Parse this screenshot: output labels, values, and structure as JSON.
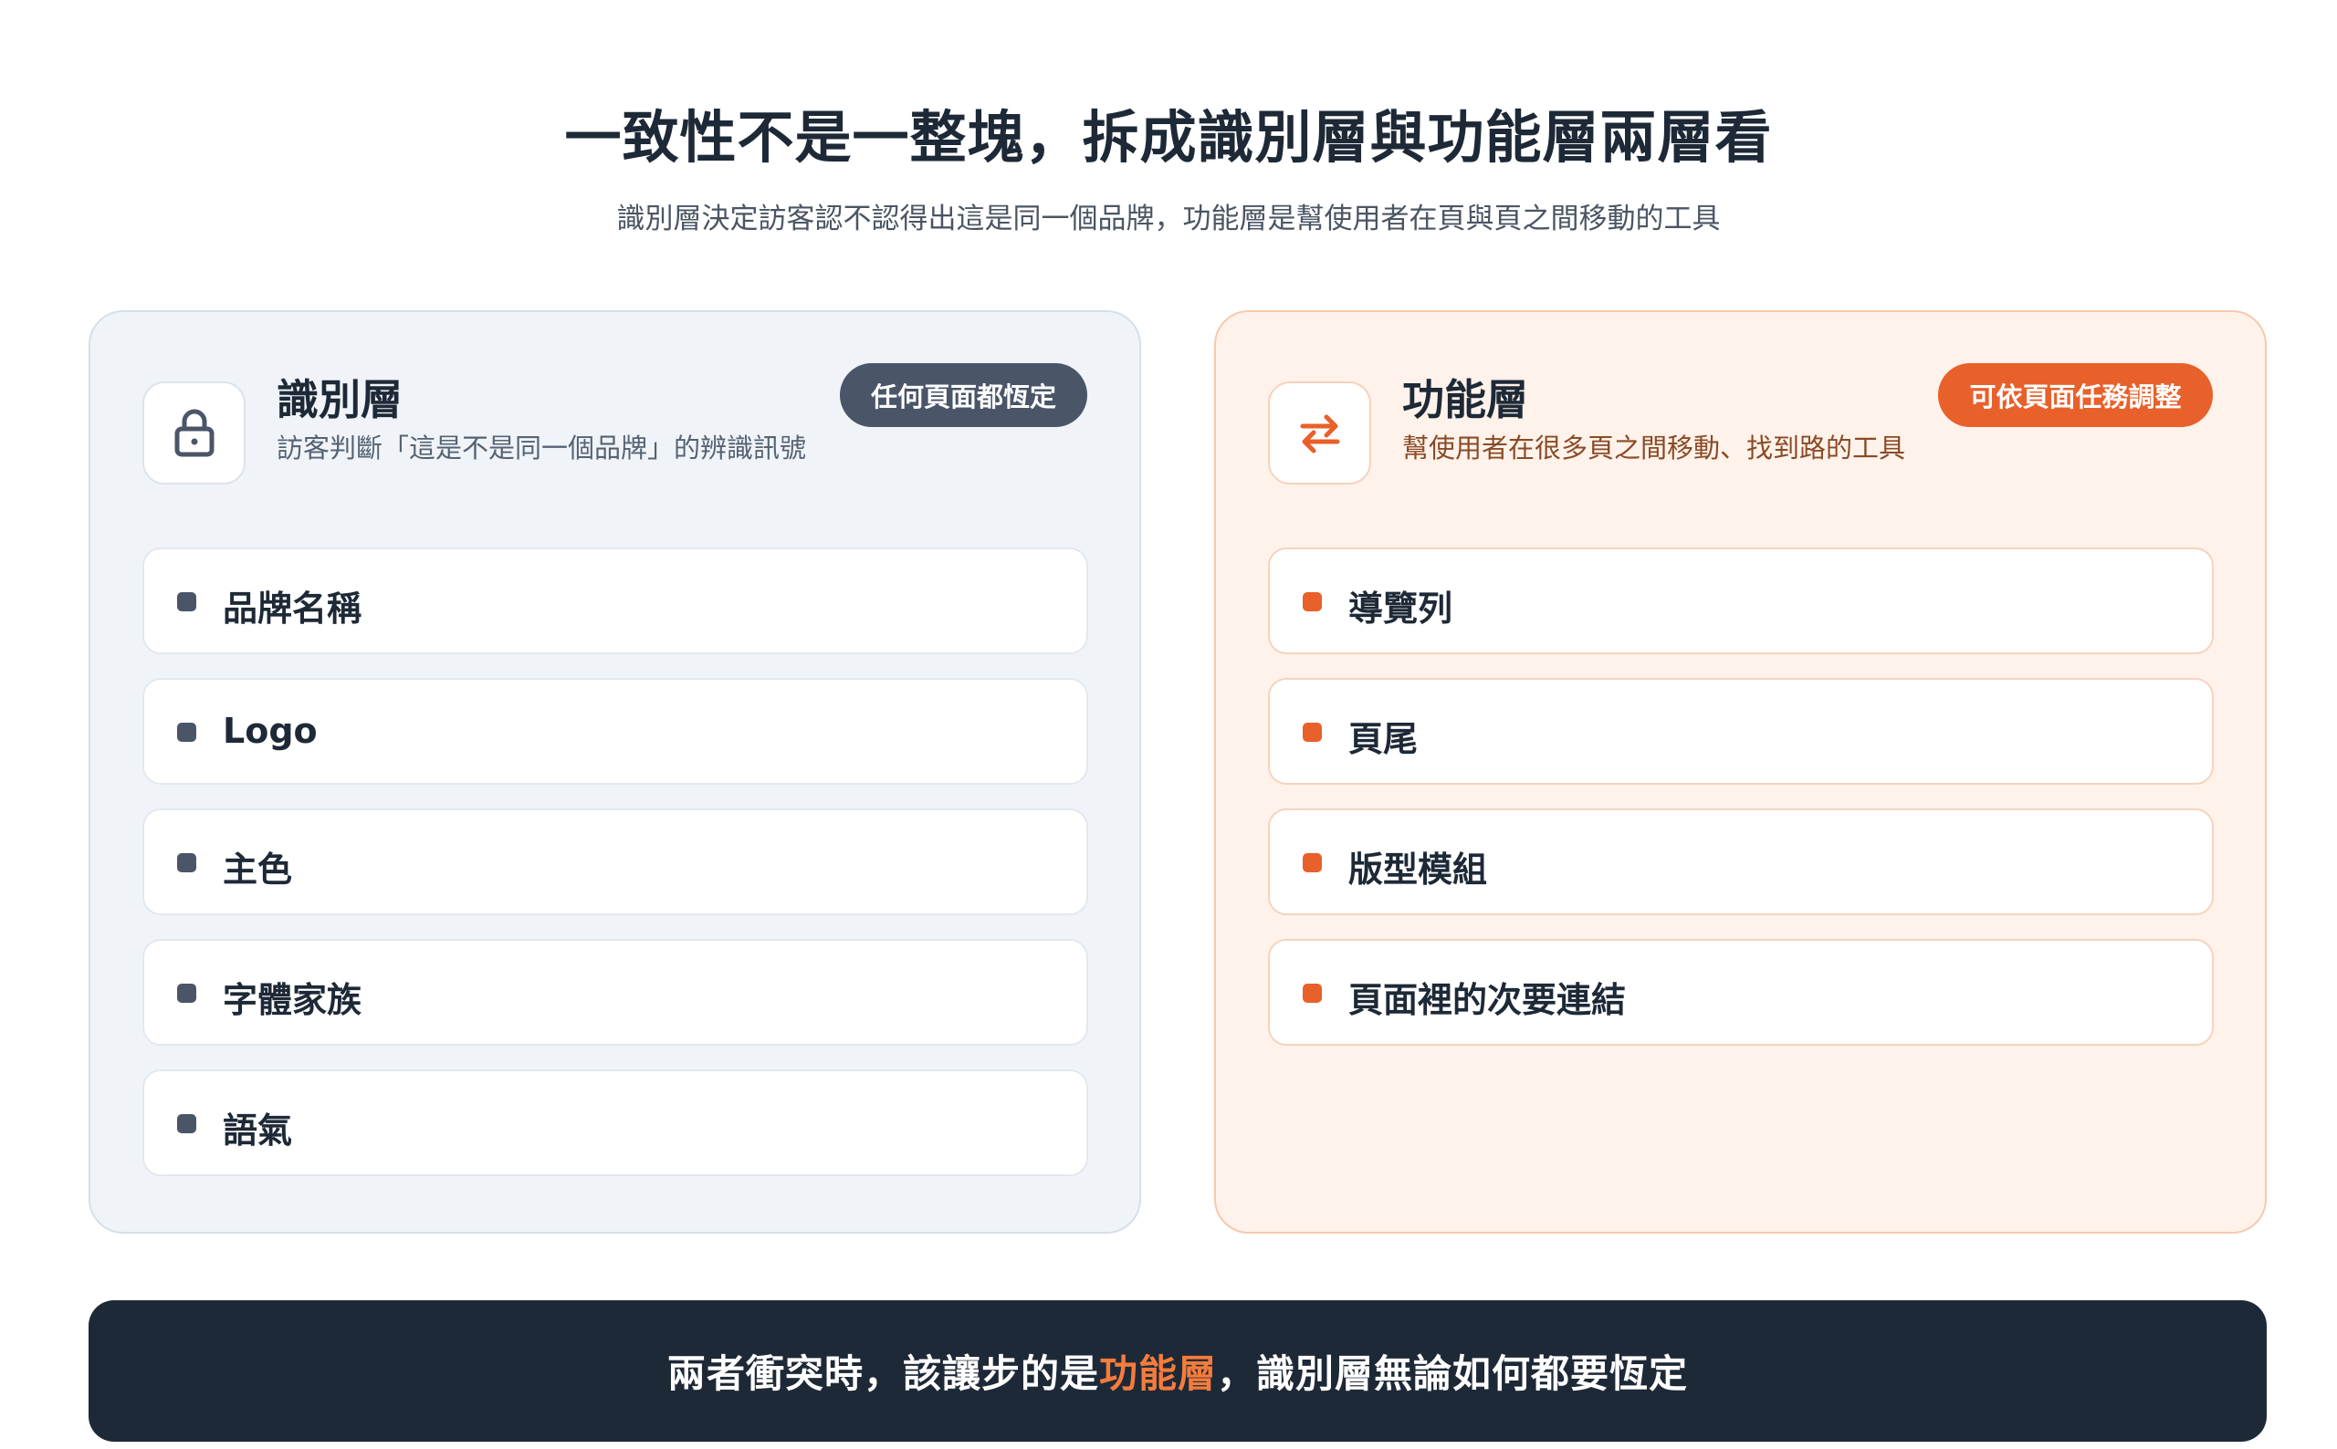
{
  "header": {
    "title": "一致性不是一整塊，拆成識別層與功能層兩層看",
    "subtitle": "識別層決定訪客認不認得出這是同一個品牌，功能層是幫使用者在頁與頁之間移動的工具"
  },
  "identity": {
    "icon": "lock-icon",
    "title": "識別層",
    "description": "訪客判斷「這是不是同一個品牌」的辨識訊號",
    "badge": "任何頁面都恆定",
    "color": "#4a5568",
    "items": [
      {
        "label": "品牌名稱"
      },
      {
        "label": "Logo"
      },
      {
        "label": "主色"
      },
      {
        "label": "字體家族"
      },
      {
        "label": "語氣"
      }
    ]
  },
  "function": {
    "icon": "swap-arrows-icon",
    "title": "功能層",
    "description": "幫使用者在很多頁之間移動、找到路的工具",
    "badge": "可依頁面任務調整",
    "color": "#e8602a",
    "items": [
      {
        "label": "導覽列"
      },
      {
        "label": "頁尾"
      },
      {
        "label": "版型模組"
      },
      {
        "label": "頁面裡的次要連結"
      }
    ]
  },
  "banner": {
    "prefix": "兩者衝突時，該讓步的是",
    "highlight": "功能層",
    "suffix": "，識別層無論如何都要恆定"
  }
}
